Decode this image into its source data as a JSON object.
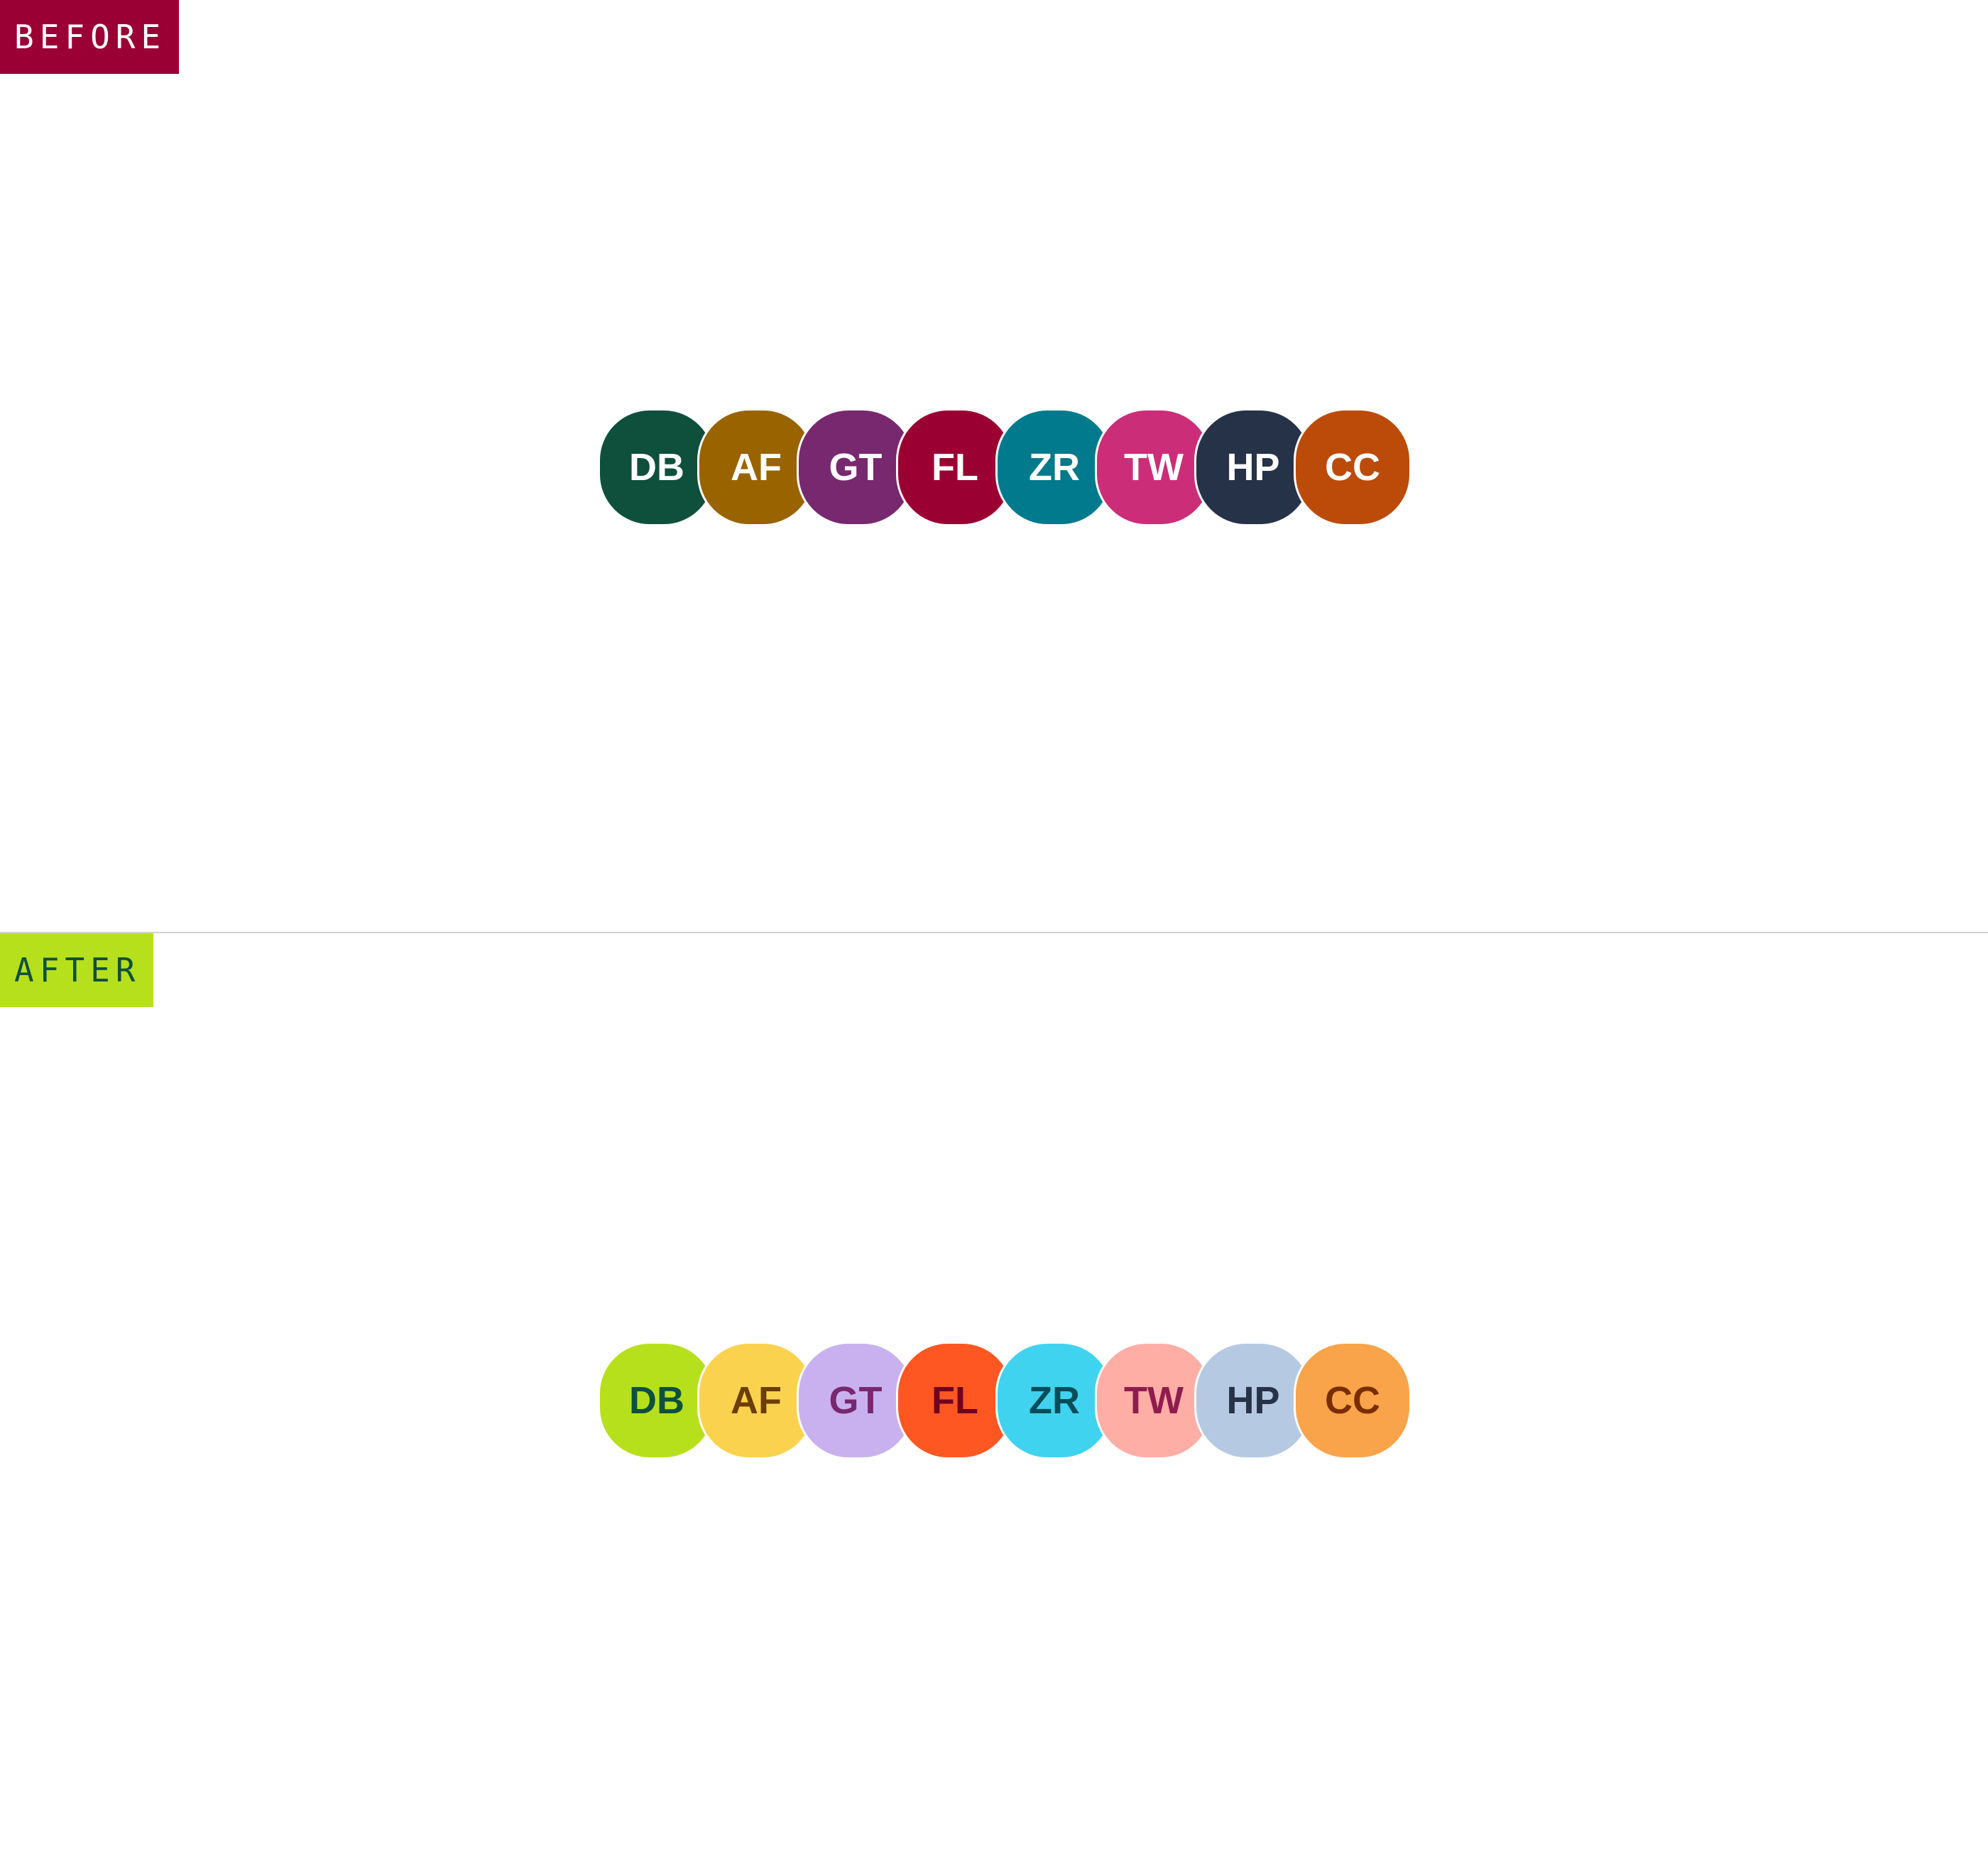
{
  "sections": [
    {
      "label": "BEFORE",
      "label_bg": "#9b0034",
      "label_color": "#ffffff",
      "avatars": [
        {
          "initials": "DB",
          "bg": "#0f503c",
          "fg": "#ffffff"
        },
        {
          "initials": "AF",
          "bg": "#996300",
          "fg": "#ffffff"
        },
        {
          "initials": "GT",
          "bg": "#78286e",
          "fg": "#ffffff"
        },
        {
          "initials": "FL",
          "bg": "#9b0032",
          "fg": "#ffffff"
        },
        {
          "initials": "ZR",
          "bg": "#007a8c",
          "fg": "#ffffff"
        },
        {
          "initials": "TW",
          "bg": "#cc2d78",
          "fg": "#ffffff"
        },
        {
          "initials": "HP",
          "bg": "#263248",
          "fg": "#ffffff"
        },
        {
          "initials": "CC",
          "bg": "#bc4b0a",
          "fg": "#ffffff"
        }
      ]
    },
    {
      "label": "AFTER",
      "label_bg": "#b7e01c",
      "label_color": "#0f503c",
      "avatars": [
        {
          "initials": "DB",
          "bg": "#b7e01c",
          "fg": "#0f503c"
        },
        {
          "initials": "AF",
          "bg": "#fbd24e",
          "fg": "#6a3f00"
        },
        {
          "initials": "GT",
          "bg": "#c9b1ef",
          "fg": "#78286e"
        },
        {
          "initials": "FL",
          "bg": "#ff5722",
          "fg": "#6e0020"
        },
        {
          "initials": "ZR",
          "bg": "#40d3ef",
          "fg": "#004e5a"
        },
        {
          "initials": "TW",
          "bg": "#ffaea6",
          "fg": "#8e1d4e"
        },
        {
          "initials": "HP",
          "bg": "#b5c9e3",
          "fg": "#263248"
        },
        {
          "initials": "CC",
          "bg": "#f9a44a",
          "fg": "#7a2e00"
        }
      ]
    }
  ]
}
